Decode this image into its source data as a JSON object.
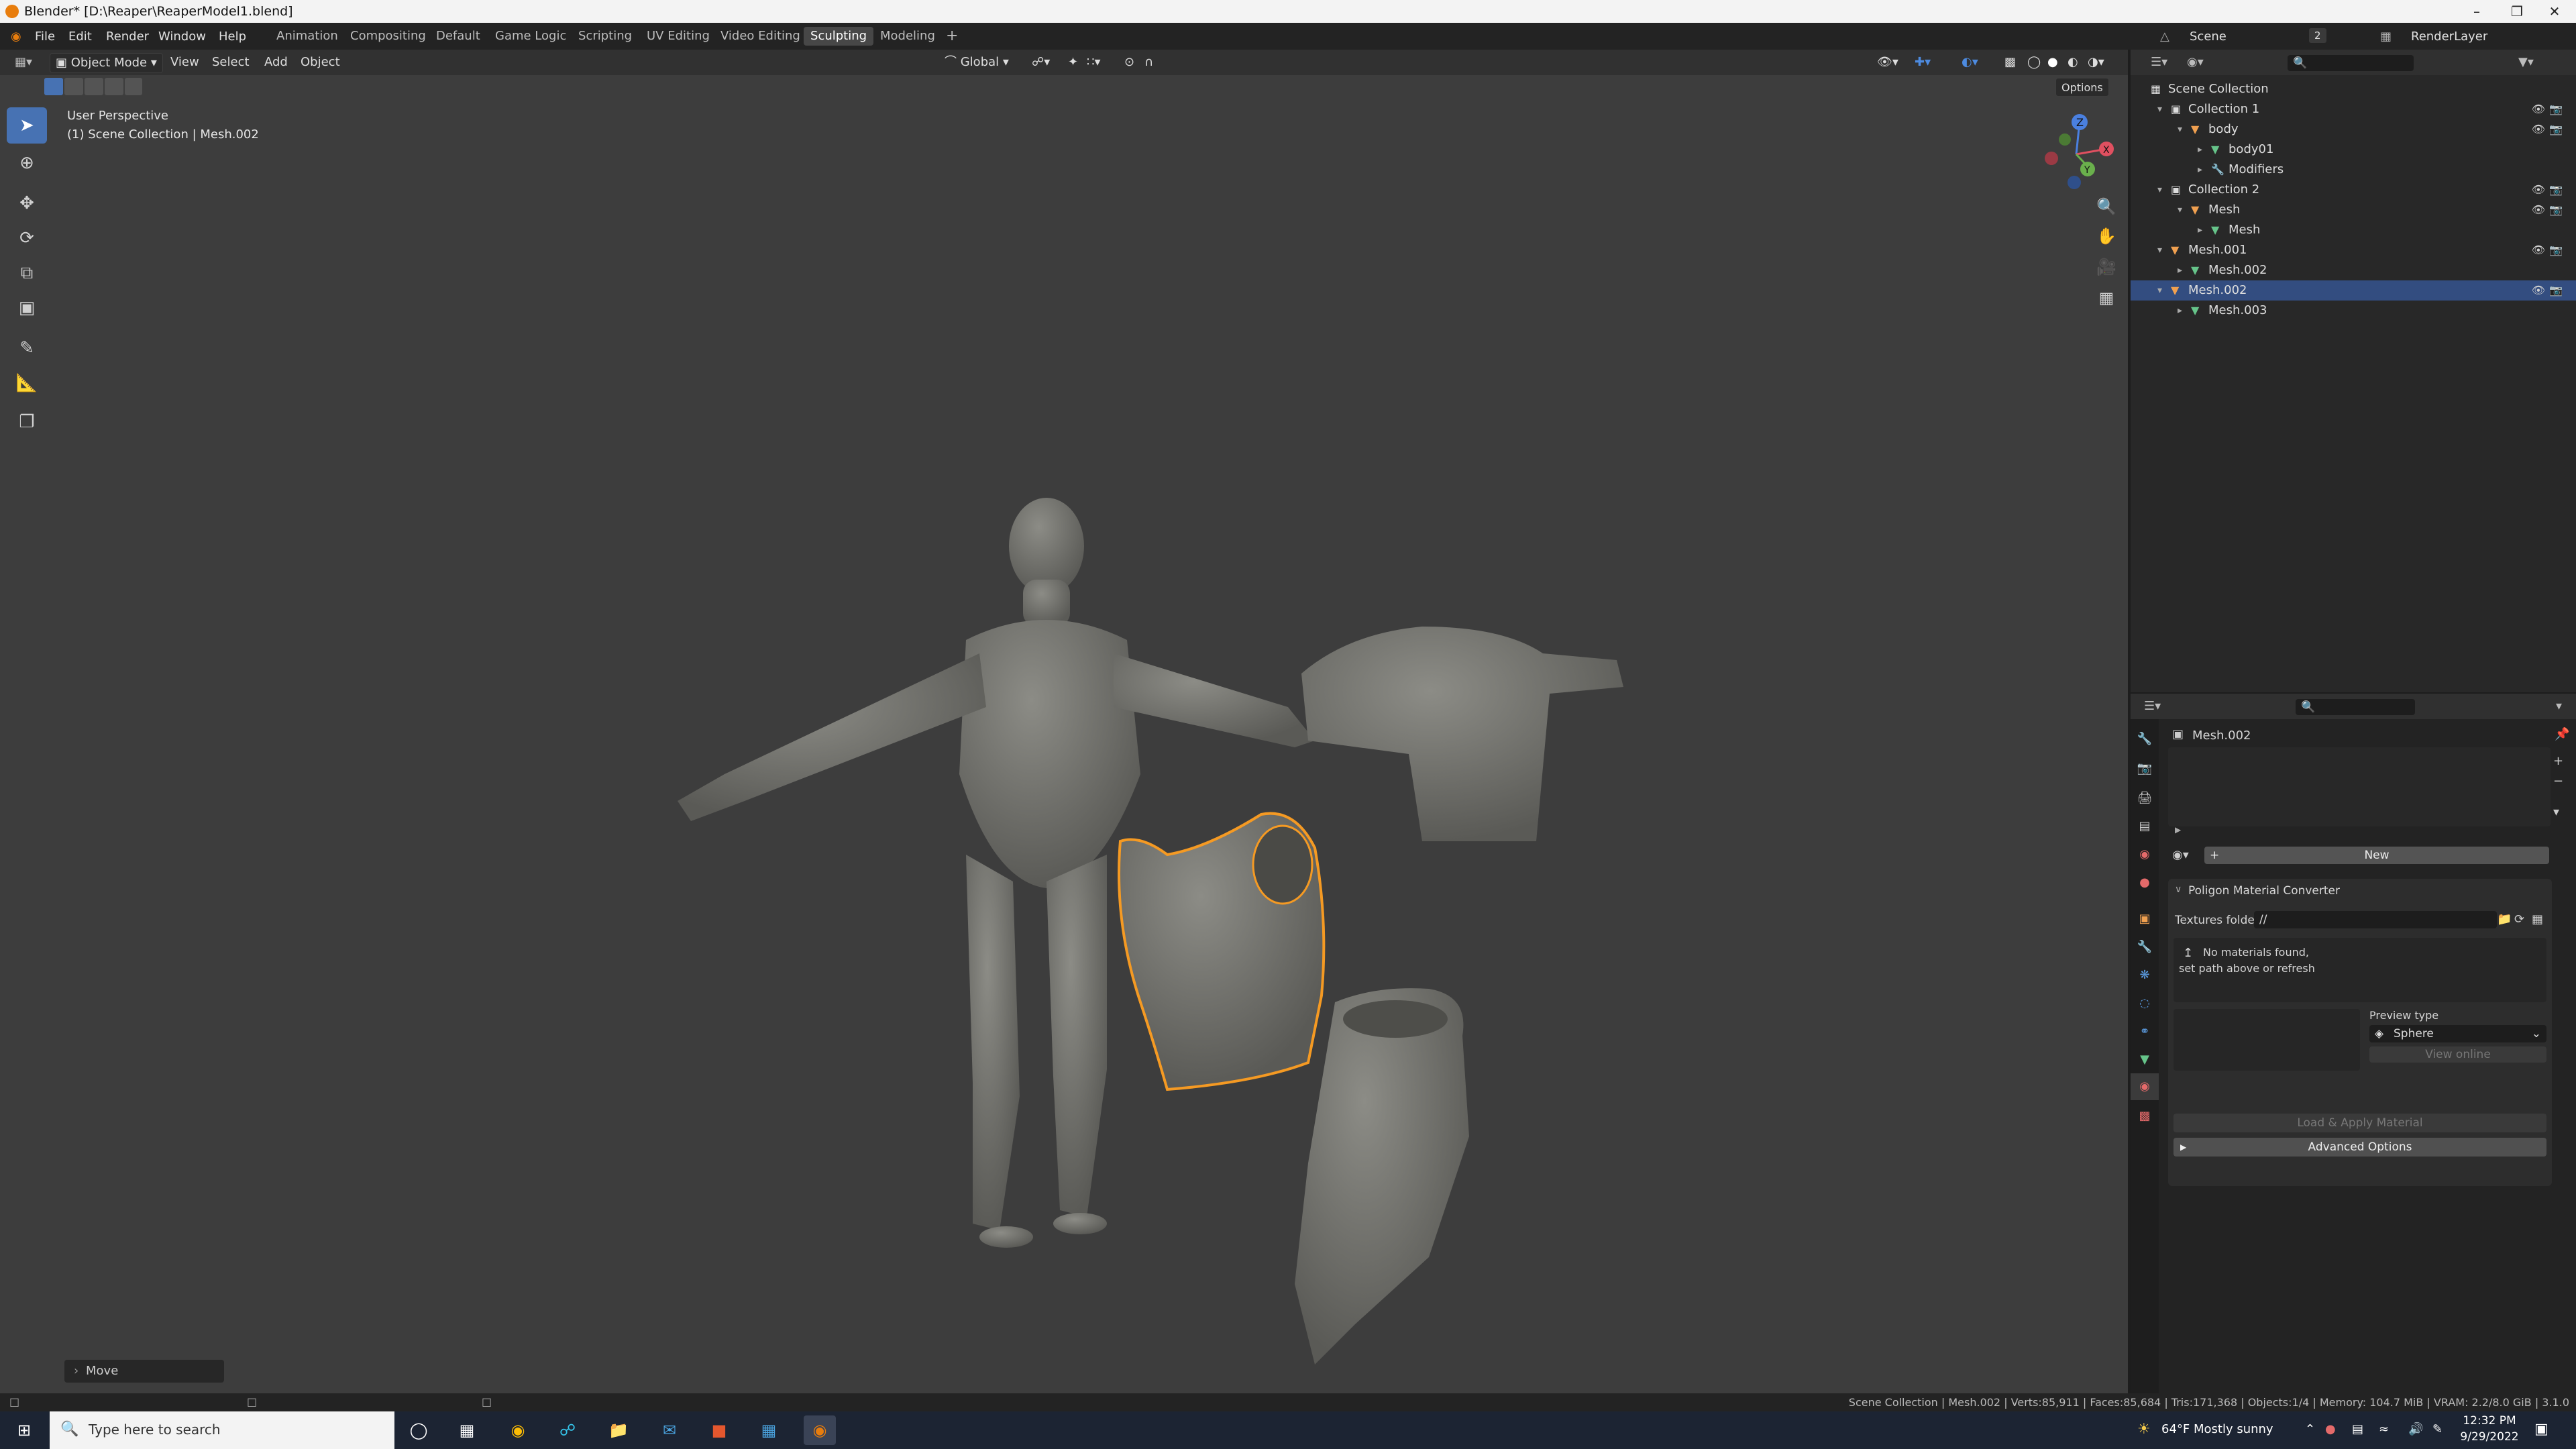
{
  "window": {
    "title": "Blender* [D:\\Reaper\\ReaperModel1.blend]"
  },
  "menus": [
    "File",
    "Edit",
    "Render",
    "Window",
    "Help"
  ],
  "workspaces": [
    "Animation",
    "Compositing",
    "Default",
    "Game Logic",
    "Scripting",
    "UV Editing",
    "Video Editing",
    "Sculpting",
    "Modeling"
  ],
  "active_workspace": "Sculpting",
  "scene": {
    "label": "Scene",
    "count": "2",
    "render_layer": "RenderLayer"
  },
  "viewport": {
    "mode": "Object Mode",
    "menus": [
      "View",
      "Select",
      "Add",
      "Object"
    ],
    "transform_orientation": "Global",
    "options_label": "Options",
    "perspective": "User Perspective",
    "collection_info": "(1) Scene Collection | Mesh.002",
    "last_operator": "Move",
    "gizmo_axes": {
      "z": "Z",
      "y": "Y",
      "x": "X"
    }
  },
  "outliner": {
    "rows": [
      {
        "label": "Scene Collection",
        "indent": 0,
        "icon": "scene-collection-icon"
      },
      {
        "label": "Collection 1",
        "indent": 1,
        "icon": "collection-icon",
        "expanded": true
      },
      {
        "label": "body",
        "indent": 2,
        "icon": "object-icon",
        "expanded": true
      },
      {
        "label": "body01",
        "indent": 3,
        "icon": "mesh-data-icon"
      },
      {
        "label": "Modifiers",
        "indent": 3,
        "icon": "wrench-icon"
      },
      {
        "label": "Collection 2",
        "indent": 1,
        "icon": "collection-icon",
        "expanded": true
      },
      {
        "label": "Mesh",
        "indent": 2,
        "icon": "object-icon",
        "expanded": true
      },
      {
        "label": "Mesh",
        "indent": 3,
        "icon": "mesh-data-icon"
      },
      {
        "label": "Mesh.001",
        "indent": 1,
        "icon": "object-icon",
        "expanded": true
      },
      {
        "label": "Mesh.002",
        "indent": 2,
        "icon": "mesh-data-icon"
      },
      {
        "label": "Mesh.002",
        "indent": 1,
        "icon": "object-icon",
        "expanded": true,
        "selected": true
      },
      {
        "label": "Mesh.003",
        "indent": 2,
        "icon": "mesh-data-icon"
      }
    ]
  },
  "properties": {
    "object_name": "Mesh.002",
    "new_label": "New",
    "panel_title": "Poligon Material Converter",
    "textures_folder_label": "Textures folder:",
    "textures_folder_value": "//",
    "message_line1": "No materials found,",
    "message_line2": "set path above or refresh",
    "preview_type_label": "Preview type",
    "preview_type_value": "Sphere",
    "view_online_label": "View online",
    "load_apply_label": "Load & Apply Material",
    "advanced_label": "Advanced Options"
  },
  "statusbar": {
    "text": "Scene Collection | Mesh.002 | Verts:85,911 | Faces:85,684 | Tris:171,368 | Objects:1/4 | Memory: 104.7 MiB | VRAM: 2.2/8.0 GiB | 3.1.0"
  },
  "taskbar": {
    "search_placeholder": "Type here to search",
    "weather": "64°F  Mostly sunny",
    "time": "12:32 PM",
    "date": "9/29/2022"
  },
  "colors": {
    "accent": "#4772b3",
    "selection_outline": "#f59a23",
    "viewport_bg": "#3d3d3d",
    "object_orange": "#f0a050",
    "mesh_green": "#66c48a"
  }
}
